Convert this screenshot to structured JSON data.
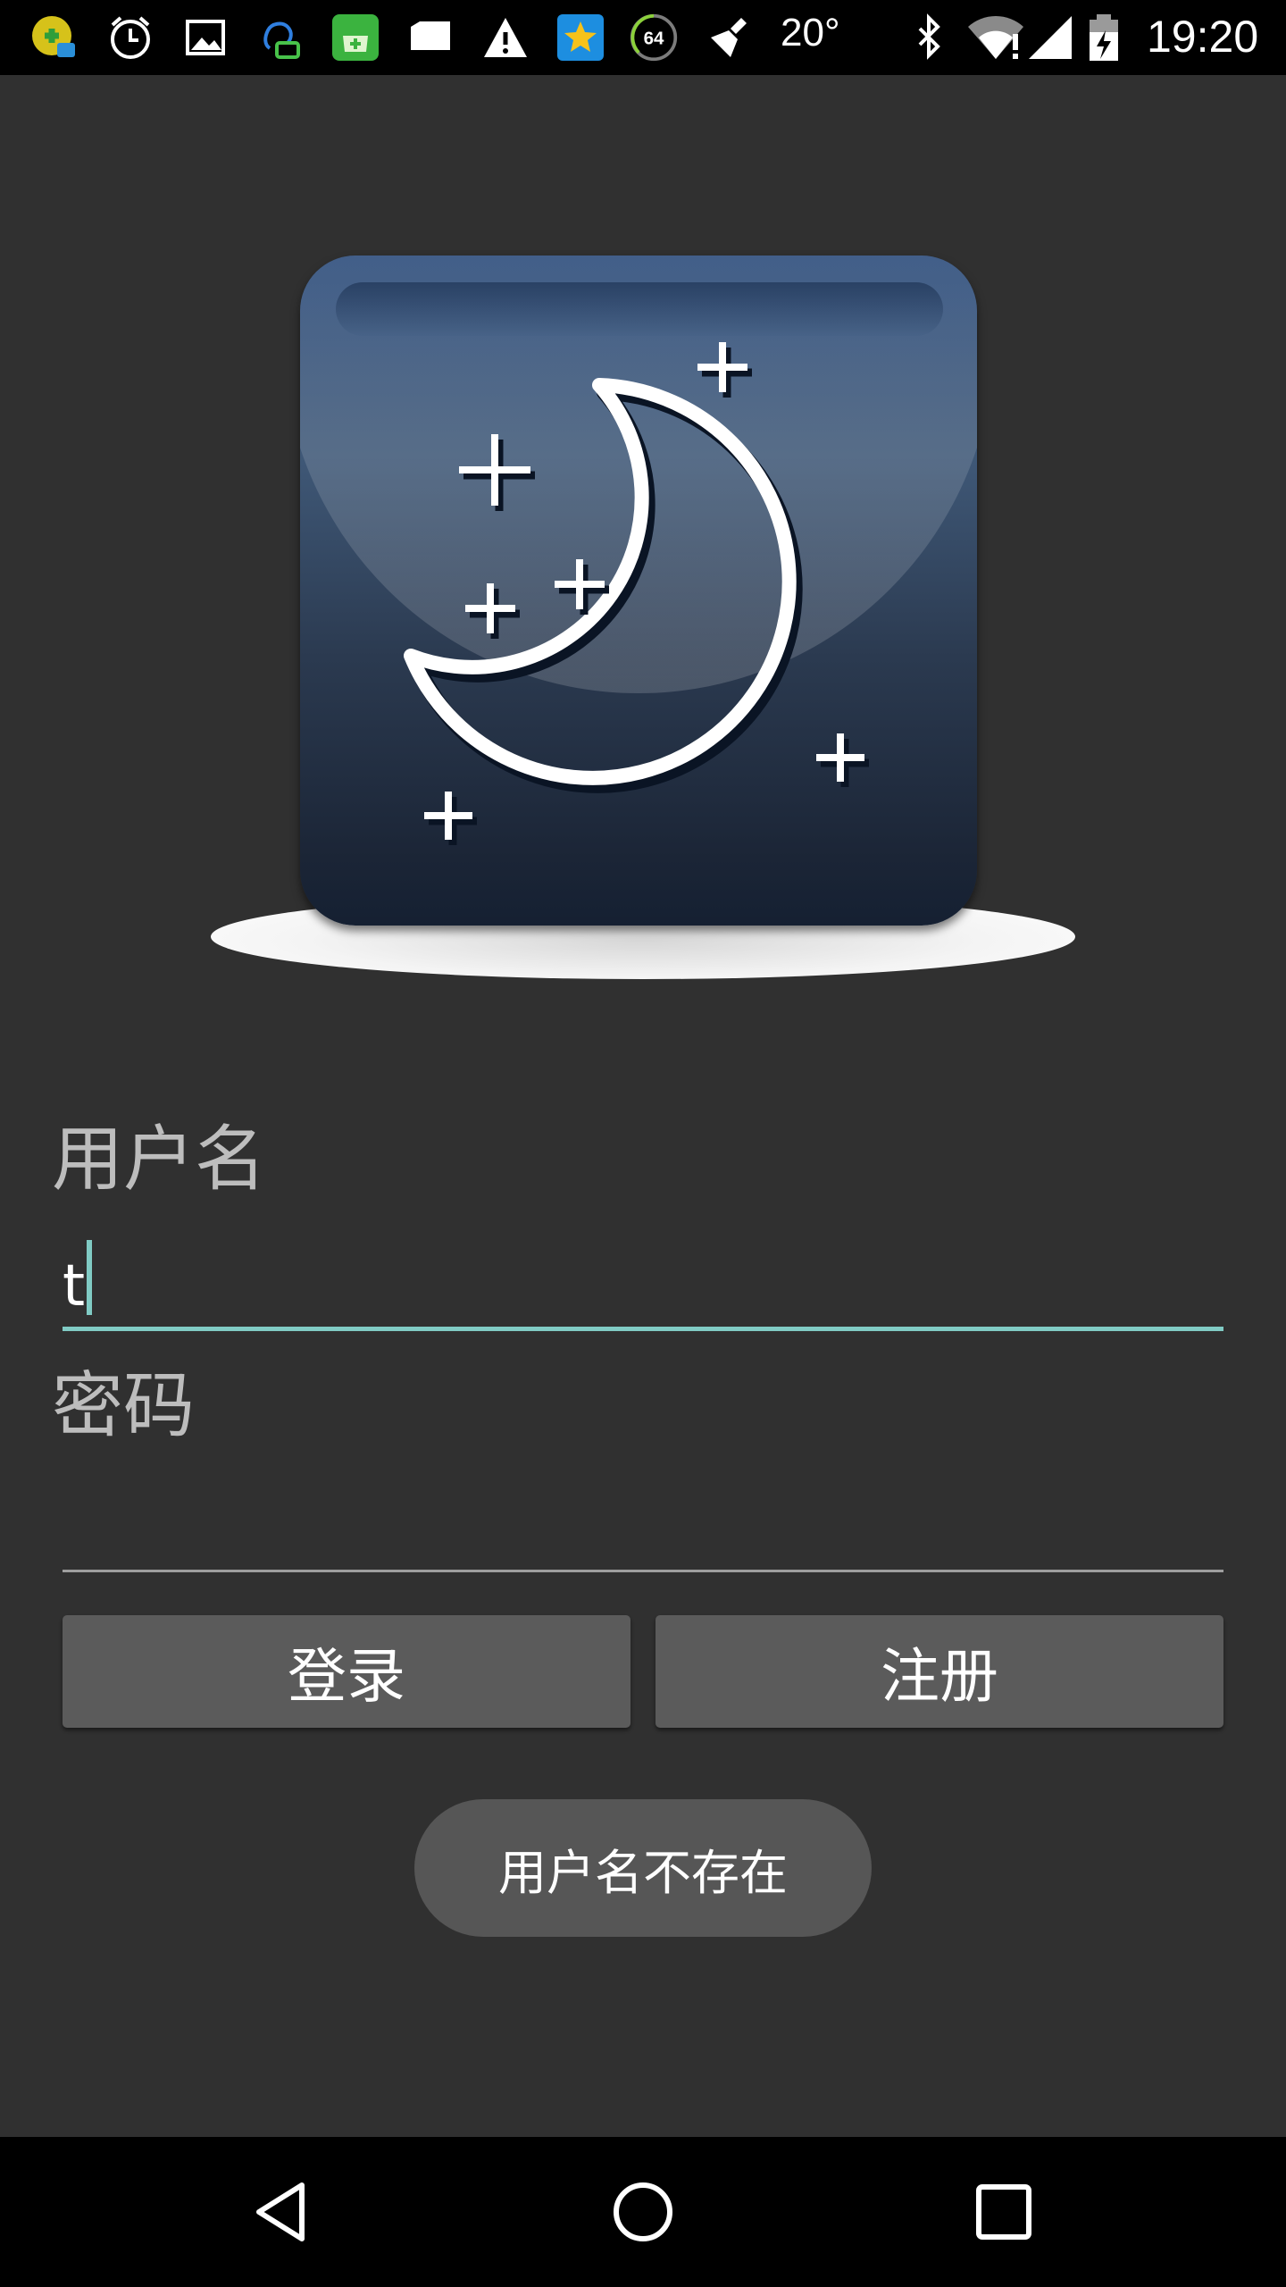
{
  "status_bar": {
    "icons": [
      "app-notification-icon",
      "alarm-clock-icon",
      "image-icon",
      "chat-bubble-icon",
      "app-store-icon",
      "message-icon",
      "warning-icon",
      "star-app-icon",
      "speed-meter-icon",
      "broom-icon",
      "bluetooth-icon",
      "wifi-icon",
      "signal-icon",
      "battery-charging-icon"
    ],
    "meter_value": "64",
    "temperature": "20°",
    "time": "19:20"
  },
  "form": {
    "username_label": "用户名",
    "username_value": "t",
    "password_label": "密码",
    "password_value": ""
  },
  "buttons": {
    "login": "登录",
    "register": "注册"
  },
  "toast": {
    "message": "用户名不存在"
  },
  "colors": {
    "background": "#303030",
    "accent": "#80cbc4",
    "button": "#5b5b5b",
    "toast": "#565656"
  },
  "nav_bar": {
    "icons": [
      "back-icon",
      "home-icon",
      "recents-icon"
    ]
  }
}
